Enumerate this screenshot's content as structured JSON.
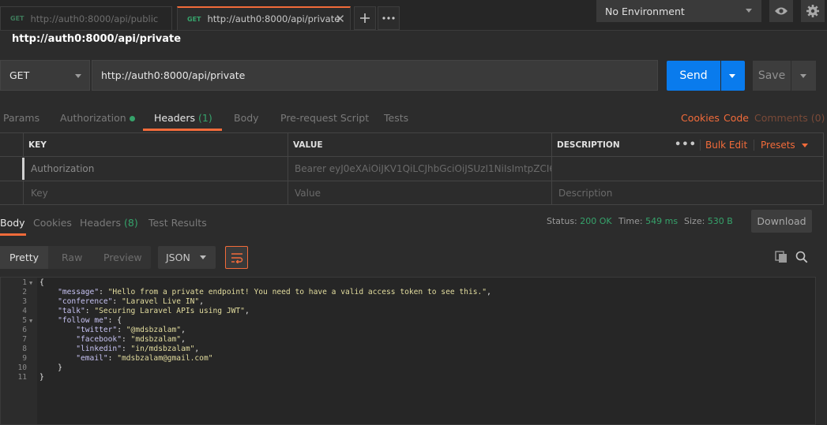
{
  "tabs": [
    {
      "method": "GET",
      "url": "http://auth0:8000/api/public",
      "active": false
    },
    {
      "method": "GET",
      "url": "http://auth0:8000/api/private",
      "active": true
    }
  ],
  "environment": {
    "selected": "No Environment"
  },
  "request": {
    "title": "http://auth0:8000/api/private",
    "method": "GET",
    "url": "http://auth0:8000/api/private",
    "send_label": "Send",
    "save_label": "Save"
  },
  "request_tabs": {
    "params": "Params",
    "authorization": "Authorization",
    "headers": "Headers",
    "headers_count": "(1)",
    "body": "Body",
    "prerequest": "Pre-request Script",
    "tests": "Tests",
    "cookies": "Cookies",
    "code": "Code",
    "comments": "Comments (0)"
  },
  "headers_table": {
    "columns": {
      "key": "KEY",
      "value": "VALUE",
      "description": "DESCRIPTION"
    },
    "more": "•••",
    "bulk_edit": "Bulk Edit",
    "presets": "Presets",
    "rows": [
      {
        "key": "Authorization",
        "value": "Bearer eyJ0eXAiOiJKV1QiLCJhbGciOiJSUzI1NiIsImtpZCI6I...",
        "description": ""
      }
    ],
    "placeholder": {
      "key": "Key",
      "value": "Value",
      "description": "Description"
    }
  },
  "response": {
    "tabs": {
      "body": "Body",
      "cookies": "Cookies",
      "headers": "Headers",
      "headers_count": "(8)",
      "test_results": "Test Results"
    },
    "status_label": "Status:",
    "status_value": "200 OK",
    "time_label": "Time:",
    "time_value": "549 ms",
    "size_label": "Size:",
    "size_value": "530 B",
    "download_label": "Download",
    "formats": {
      "pretty": "Pretty",
      "raw": "Raw",
      "preview": "Preview"
    },
    "language": "JSON",
    "code_lines": [
      {
        "n": "1",
        "fold": true,
        "text": "{"
      },
      {
        "n": "2",
        "fold": false,
        "text": "    \"message\": \"Hello from a private endpoint! You need to have a valid access token to see this.\","
      },
      {
        "n": "3",
        "fold": false,
        "text": "    \"conference\": \"Laravel Live IN\","
      },
      {
        "n": "4",
        "fold": false,
        "text": "    \"talk\": \"Securing Laravel APIs using JWT\","
      },
      {
        "n": "5",
        "fold": true,
        "text": "    \"follow me\": {"
      },
      {
        "n": "6",
        "fold": false,
        "text": "        \"twitter\": \"@mdsbzalam\","
      },
      {
        "n": "7",
        "fold": false,
        "text": "        \"facebook\": \"mdsbzalam\","
      },
      {
        "n": "8",
        "fold": false,
        "text": "        \"linkedin\": \"in/mdsbzalam\","
      },
      {
        "n": "9",
        "fold": false,
        "text": "        \"email\": \"mdsbzalam@gmail.com\""
      },
      {
        "n": "10",
        "fold": false,
        "text": "    }"
      },
      {
        "n": "11",
        "fold": false,
        "text": "}"
      }
    ]
  },
  "icons": {
    "add_tab": "plus-icon",
    "more_tabs": "ellipsis-icon",
    "eye": "eye-icon",
    "settings": "gear-icon",
    "wrap": "wrap-lines-icon",
    "copy": "copy-icon",
    "search": "search-icon"
  },
  "colors": {
    "accent": "#f26b3a",
    "send": "#097bed",
    "success": "#36a36b"
  }
}
